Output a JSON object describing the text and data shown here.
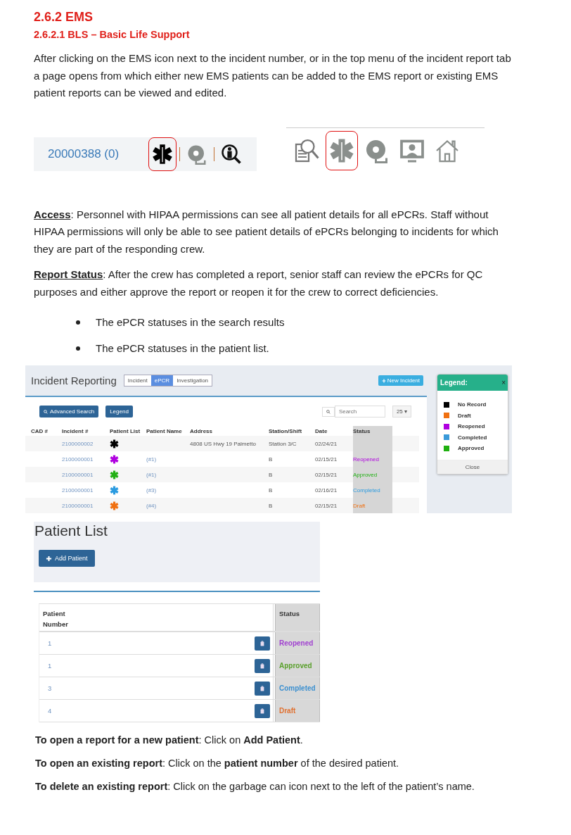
{
  "heading": "2.6.2 EMS",
  "subheading": "2.6.2.1 BLS – Basic Life Support",
  "intro": "After clicking on the EMS icon next to the incident number, or in the top menu of the incident report tab a page opens from which either new EMS patients can be added to the EMS report or existing EMS patient reports can be viewed and edited.",
  "incident_strip": {
    "incident_number": "20000388 (0)",
    "icons": [
      {
        "kind": "star",
        "highlighted": true
      },
      {
        "kind": "bell",
        "highlighted": false
      },
      {
        "kind": "person-search",
        "highlighted": false
      }
    ]
  },
  "top_menu": {
    "icons": [
      {
        "kind": "doc-search",
        "highlighted": false
      },
      {
        "kind": "star",
        "highlighted": true
      },
      {
        "kind": "bell",
        "highlighted": false
      },
      {
        "kind": "presenter",
        "highlighted": false
      },
      {
        "kind": "home",
        "highlighted": false
      }
    ]
  },
  "paragraphs": [
    "**Access**: Personnel with HIPAA permissions can see all patient details for all ePCRs. Staff without HIPAA permissions will only be able to see patient details of ePCRs belonging to incidents for which they are part of the responding crew.",
    "**Report Status**: After the crew has completed a report, senior staff can review the ePCRs for QC purposes and either approve the report or reopen it for the crew to correct deficiencies."
  ],
  "bullets": [
    "The ePCR statuses in the search results",
    "The ePCR statuses in the patient list."
  ],
  "incident_reporting": {
    "title": "Incident Reporting",
    "tabs": [
      {
        "label": "Incident",
        "selected": false
      },
      {
        "label": "ePCR",
        "selected": true
      },
      {
        "label": "Investigation",
        "selected": false
      }
    ],
    "new_incident_button": "New Incident",
    "advanced_search_button": "Advanced Search",
    "legend_button": "Legend",
    "search": {
      "placeholder": "Search"
    },
    "page_size": "25 ▾",
    "columns": [
      "CAD #",
      "Incident #",
      "Patient List",
      "Patient Name",
      "Address",
      "Station/Shift",
      "Date",
      "Status"
    ],
    "rows": [
      {
        "incident": "2100000002",
        "color": "#000000",
        "address": "4808 US Hwy 19 Palmetto",
        "station": "Station 3/C",
        "date": "02/24/21"
      },
      {
        "incident": "2100000001",
        "color": "#b000e0",
        "patient_name": "(#1)",
        "station": "B",
        "date": "02/15/21",
        "status": "Reopened"
      },
      {
        "incident": "2100000001",
        "color": "#22b014",
        "patient_name": "(#1)",
        "station": "B",
        "date": "02/15/21",
        "status": "Approved"
      },
      {
        "incident": "2100000001",
        "color": "#2a9be0",
        "patient_name": "(#3)",
        "station": "B",
        "date": "02/16/21",
        "status": "Completed"
      },
      {
        "incident": "2100000001",
        "color": "#f07010",
        "patient_name": "(#4)",
        "station": "B",
        "date": "02/15/21",
        "status": "Draft"
      }
    ]
  },
  "legend": {
    "title": "Legend:",
    "close_icon": "×",
    "items": [
      {
        "label": "No Record",
        "color": "#000000"
      },
      {
        "label": "Draft",
        "color": "#f07010"
      },
      {
        "label": "Reopened",
        "color": "#b000e0"
      },
      {
        "label": "Completed",
        "color": "#3a9ad9"
      },
      {
        "label": "Approved",
        "color": "#1fb010"
      }
    ],
    "close_button": "Close"
  },
  "patient_list": {
    "title": "Patient List",
    "add_button": "Add Patient",
    "columns": [
      "Patient Number",
      "Status"
    ],
    "rows": [
      {
        "number": "1",
        "status": "Reopened",
        "color": "#a040d0"
      },
      {
        "number": "1",
        "status": "Approved",
        "color": "#5aa02c"
      },
      {
        "number": "3",
        "status": "Completed",
        "color": "#3a8fd0"
      },
      {
        "number": "4",
        "status": "Draft",
        "color": "#e07030"
      }
    ]
  },
  "instructions": [
    "**To open a report for a new patient**: Click on **Add Patient**.",
    "**To open an existing report**: Click on the **patient number** of the desired patient.",
    "**To delete an existing report**: Click on the garbage can icon next to the left of the patient’s name."
  ]
}
